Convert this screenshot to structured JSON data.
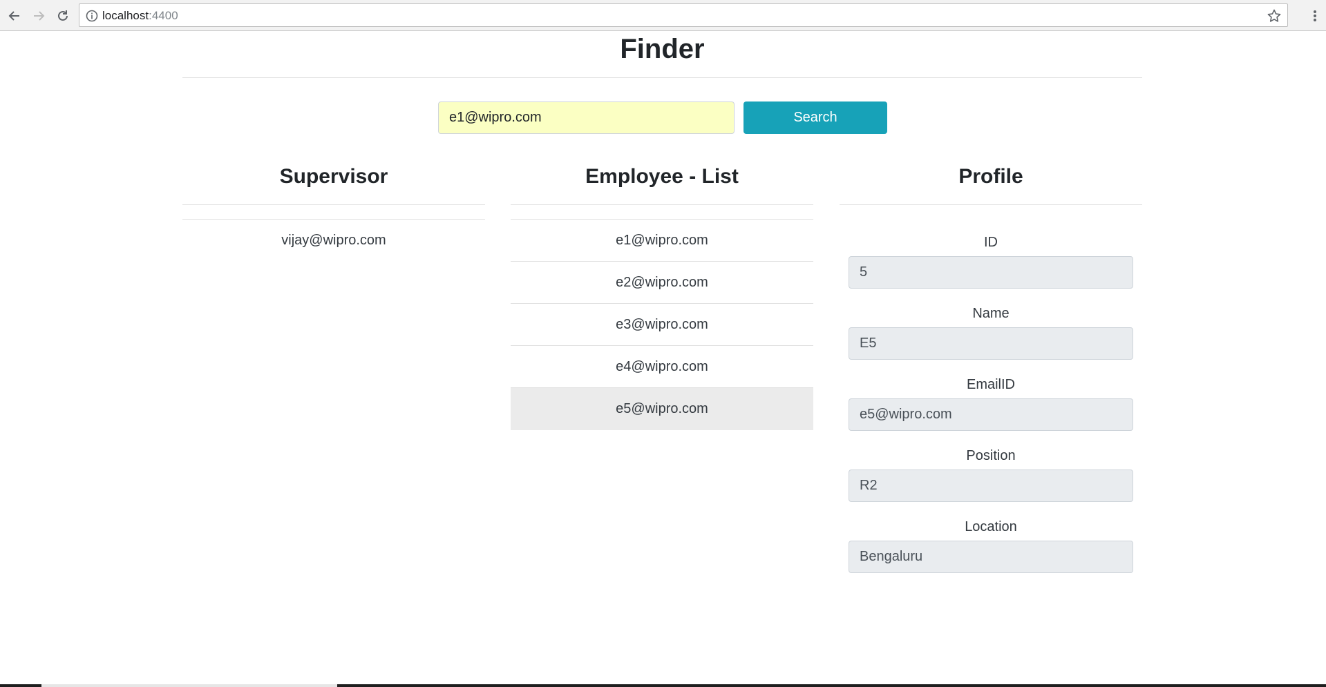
{
  "browser": {
    "url_host": "localhost",
    "url_port": ":4400"
  },
  "page": {
    "title": "Finder"
  },
  "search": {
    "value": "e1@wipro.com",
    "button_label": "Search"
  },
  "supervisor": {
    "heading": "Supervisor",
    "items": [
      "vijay@wipro.com"
    ]
  },
  "employee_list": {
    "heading": "Employee - List",
    "items": [
      "e1@wipro.com",
      "e2@wipro.com",
      "e3@wipro.com",
      "e4@wipro.com",
      "e5@wipro.com"
    ],
    "selected_index": 4
  },
  "profile": {
    "heading": "Profile",
    "fields": [
      {
        "label": "ID",
        "value": "5"
      },
      {
        "label": "Name",
        "value": "E5"
      },
      {
        "label": "EmailID",
        "value": "e5@wipro.com"
      },
      {
        "label": "Position",
        "value": "R2"
      },
      {
        "label": "Location",
        "value": "Bengaluru"
      }
    ]
  },
  "colors": {
    "search_button": "#17a2b8",
    "search_input_bg": "#fbffc3",
    "selected_row_bg": "#ebebeb",
    "readonly_field_bg": "#e9ecef"
  },
  "icons": [
    "back-icon",
    "forward-icon",
    "reload-icon",
    "info-icon",
    "star-icon",
    "kebab-menu-icon"
  ]
}
